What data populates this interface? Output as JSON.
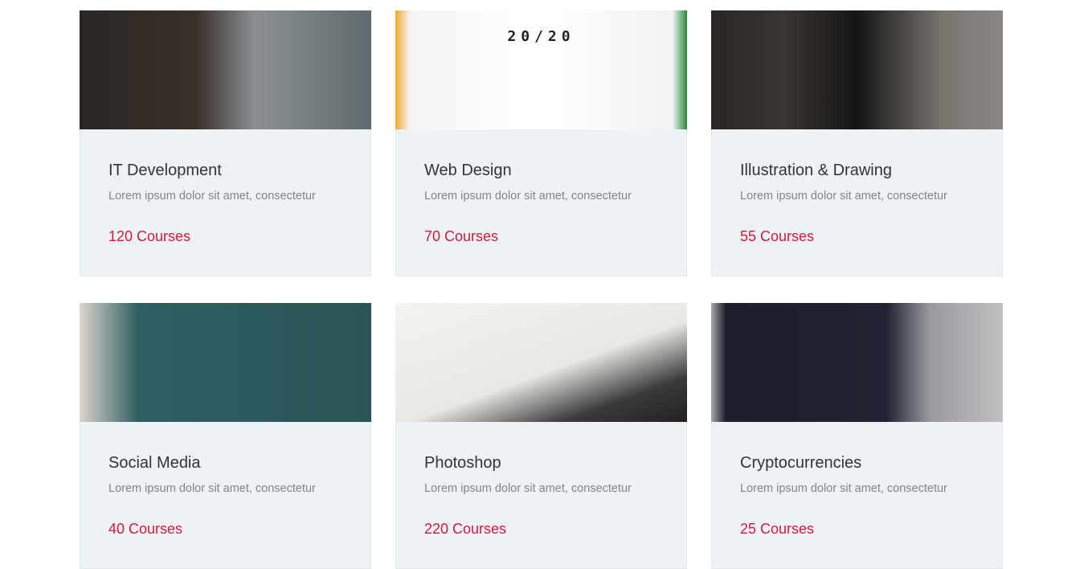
{
  "categories": [
    {
      "title": "IT Development",
      "description": "Lorem ipsum dolor sit amet, consectetur",
      "count": "120 Courses",
      "image": "person-at-laptop"
    },
    {
      "title": "Web Design",
      "description": "Lorem ipsum dolor sit amet, consectetur",
      "count": "70 Courses",
      "image": "shirt-20-20",
      "image_text": "20/20"
    },
    {
      "title": "Illustration & Drawing",
      "description": "Lorem ipsum dolor sit amet, consectetur",
      "count": "55 Courses",
      "image": "person-with-camera"
    },
    {
      "title": "Social Media",
      "description": "Lorem ipsum dolor sit amet, consectetur",
      "count": "40 Courses",
      "image": "teacher-at-blackboard"
    },
    {
      "title": "Photoshop",
      "description": "Lorem ipsum dolor sit amet, consectetur",
      "count": "220 Courses",
      "image": "laptop-code-closeup"
    },
    {
      "title": "Cryptocurrencies",
      "description": "Lorem ipsum dolor sit amet, consectetur",
      "count": "25 Courses",
      "image": "laptop-with-plant"
    }
  ],
  "colors": {
    "accent": "#d3193c",
    "card_bg": "#edf3f5",
    "title": "#333333",
    "text": "#848484"
  }
}
